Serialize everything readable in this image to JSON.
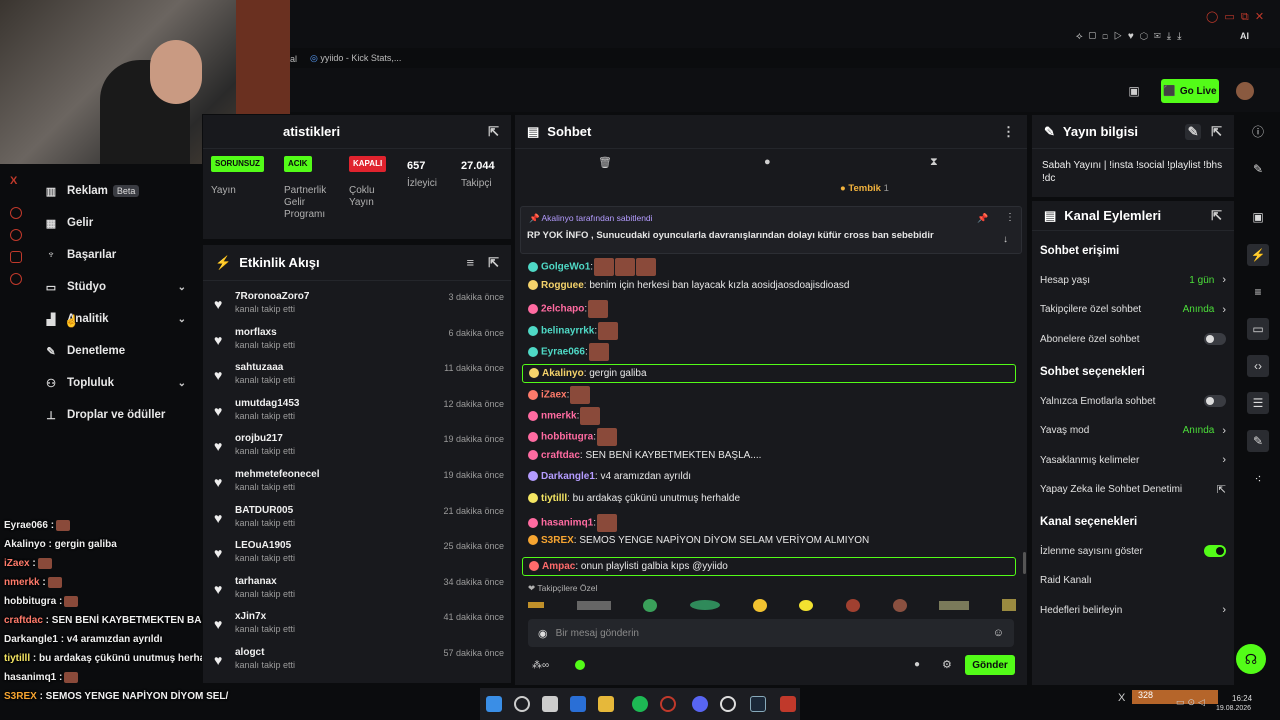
{
  "browser": {
    "tab_label_1": "ial",
    "tab_label_2": "yyiido - Kick Stats,..."
  },
  "top": {
    "go_live": "Go Live"
  },
  "left_menu": {
    "items": [
      {
        "label": "Reklam",
        "badge": "Beta",
        "icon": "megaphone-icon"
      },
      {
        "label": "Gelir",
        "icon": "revenue-icon"
      },
      {
        "label": "Başarılar",
        "icon": "trophy-icon"
      },
      {
        "label": "Stüdyo",
        "icon": "studio-icon",
        "chevron": true
      },
      {
        "label": "Analitik",
        "icon": "analytics-icon",
        "chevron": true
      },
      {
        "label": "Denetleme",
        "icon": "wrench-icon"
      },
      {
        "label": "Topluluk",
        "icon": "community-icon",
        "chevron": true
      },
      {
        "label": "Droplar ve ödüller",
        "icon": "drops-icon"
      }
    ]
  },
  "overlay_chat": [
    {
      "user": "Eyrae066",
      "text": " :",
      "color": "#f0f0f0"
    },
    {
      "user": "Akalinyo",
      "text": " : gergin galiba",
      "color": "#f0f0f0"
    },
    {
      "user": "iZaex",
      "text": " :",
      "color": "#ff7b6b"
    },
    {
      "user": "nmerkk",
      "text": " :",
      "color": "#ff7b6b"
    },
    {
      "user": "hobbitugra",
      "text": " :",
      "color": "#f0f0f0"
    },
    {
      "user": "craftdac",
      "text": " : SEN BENİ KAYBETMEKTEN BAŞLA...",
      "color": "#ff7b6b"
    },
    {
      "user": "Darkangle1",
      "text": " : v4 aramızdan ayrıldı",
      "color": "#f0f0f0"
    },
    {
      "user": "tiytilll",
      "text": " : bu ardakaş çükünü unutmuş herhalde",
      "color": "#f5e663"
    },
    {
      "user": "hasanimq1",
      "text": " :",
      "color": "#f0f0f0"
    },
    {
      "user": "S3REX",
      "text": " : SEMOS YENGE NAPİYON DİYOM SEL/",
      "color": "#f7a531"
    }
  ],
  "stats": {
    "title": "atistikleri",
    "cols": [
      {
        "pill": "SORUNSUZ",
        "pill_bg": "#53fc18",
        "pill_fg": "#0b0c0e",
        "label": "Yayın"
      },
      {
        "pill": "ACIK",
        "pill_bg": "#53fc18",
        "pill_fg": "#0b0c0e",
        "label": "Partnerlik Gelir Programı"
      },
      {
        "pill": "KAPALI",
        "pill_bg": "#e0232e",
        "pill_fg": "#ffffff",
        "label": "Çoklu Yayın"
      },
      {
        "value": "657",
        "label": "İzleyici"
      },
      {
        "value": "27.044",
        "label": "Takipçi"
      }
    ]
  },
  "activity": {
    "title": "Etkinlik Akışı",
    "rows": [
      {
        "name": "7RoronoaZoro7",
        "sub": "kanalı takip etti",
        "time": "3 dakika önce"
      },
      {
        "name": "morflaxs",
        "sub": "kanalı takip etti",
        "time": "6 dakika önce"
      },
      {
        "name": "sahtuzaaa",
        "sub": "kanalı takip etti",
        "time": "11 dakika önce"
      },
      {
        "name": "umutdag1453",
        "sub": "kanalı takip etti",
        "time": "12 dakika önce"
      },
      {
        "name": "orojbu217",
        "sub": "kanalı takip etti",
        "time": "19 dakika önce"
      },
      {
        "name": "mehmetefeonecel",
        "sub": "kanalı takip etti",
        "time": "19 dakika önce"
      },
      {
        "name": "BATDUR005",
        "sub": "kanalı takip etti",
        "time": "21 dakika önce"
      },
      {
        "name": "LEOuA1905",
        "sub": "kanalı takip etti",
        "time": "25 dakika önce"
      },
      {
        "name": "tarhanax",
        "sub": "kanalı takip etti",
        "time": "34 dakika önce"
      },
      {
        "name": "xJin7x",
        "sub": "kanalı takip etti",
        "time": "41 dakika önce"
      },
      {
        "name": "alogct",
        "sub": "kanalı takip etti",
        "time": "57 dakika önce"
      }
    ]
  },
  "chat": {
    "title": "Sohbet",
    "top_label": "Tembik",
    "top_count": "1",
    "pinned_by": "Akalinyo tarafından sabitlendi",
    "pinned_text": "RP YOK  İNFO , Sunucudaki oyuncularla davranışlarından dolayı küfür cross ban sebebidir",
    "messages": [
      {
        "user": "GolgeWo1",
        "text": ":",
        "color": "#4fd9c6",
        "emotes": 3
      },
      {
        "user": "Rogguee",
        "text": ": benim için herkesi ban layacak kızla aosidjaosdoajisdioasd",
        "color": "#f5d36b",
        "emotes": 0
      },
      {
        "user": "2elchapo",
        "text": ":",
        "color": "#ff6ba1",
        "emotes": 1
      },
      {
        "user": "belinayrrkk",
        "text": ":",
        "color": "#4fd9c6",
        "emotes": 1
      },
      {
        "user": "Eyrae066",
        "text": ":",
        "color": "#4fd9c6",
        "emotes": 1
      },
      {
        "user": "Akalinyo",
        "text": ": gergin galiba",
        "color": "#f5d36b",
        "emotes": 0
      },
      {
        "user": "iZaex",
        "text": ":",
        "color": "#ff7b6b",
        "emotes": 1
      },
      {
        "user": "nmerkk",
        "text": ":",
        "color": "#ff6ba1",
        "emotes": 1
      },
      {
        "user": "hobbitugra",
        "text": ":",
        "color": "#ff6ba1",
        "emotes": 1
      },
      {
        "user": "craftdac",
        "text": ": SEN BENİ KAYBETMEKTEN BAŞLA....",
        "color": "#ff6ba1",
        "emotes": 0
      },
      {
        "user": "Darkangle1",
        "text": ": v4 aramızdan ayrıldı",
        "color": "#b49cff",
        "emotes": 0
      },
      {
        "user": "tiytilll",
        "text": ": bu ardakaş çükünü unutmuş herhalde",
        "color": "#f5e663",
        "emotes": 0
      },
      {
        "user": "hasanimq1",
        "text": ":",
        "color": "#ff6ba1",
        "emotes": 1
      },
      {
        "user": "S3REX",
        "text": ": SEMOS YENGE NAPİYON DİYOM SELAM VERİYOM ALMIYON",
        "color": "#f7a531",
        "emotes": 0
      },
      {
        "user": "Ampac",
        "text": ": onun playlisti galbia kıps @yyiido",
        "color": "#ff6b6b",
        "emotes": 0
      }
    ],
    "followers_only": "Takipçilere Özel",
    "input_placeholder": "Bir mesaj gönderin",
    "send": "Gönder"
  },
  "stream_info": {
    "title": "Yayın bilgisi",
    "text": "Sabah Yayını | !insta !social !playlist !bhs !dc"
  },
  "channel_actions": {
    "title": "Kanal Eylemleri",
    "sections": [
      {
        "heading": "Sohbet erişimi",
        "rows": [
          {
            "label": "Hesap yaşı",
            "value": "1 gün",
            "type": "chevron"
          },
          {
            "label": "Takipçilere özel sohbet",
            "value": "Anında",
            "type": "chevron"
          },
          {
            "label": "Abonelere özel sohbet",
            "value": "",
            "type": "toggle-off"
          }
        ]
      },
      {
        "heading": "Sohbet seçenekleri",
        "rows": [
          {
            "label": "Yalnızca Emotlarla sohbet",
            "value": "",
            "type": "toggle-off"
          },
          {
            "label": "Yavaş mod",
            "value": "Anında",
            "type": "chevron"
          },
          {
            "label": "Yasaklanmış kelimeler",
            "value": "",
            "type": "chevron"
          },
          {
            "label": "Yapay Zeka ile Sohbet Denetimi",
            "value": "",
            "type": "external"
          }
        ]
      },
      {
        "heading": "Kanal seçenekleri",
        "rows": [
          {
            "label": "İzlenme sayısını göster",
            "value": "",
            "type": "toggle-on"
          },
          {
            "label": "Raid Kanalı",
            "value": "",
            "type": "none"
          },
          {
            "label": "Hedefleri belirleyin",
            "value": "",
            "type": "chevron"
          }
        ]
      }
    ]
  },
  "taskbar": {
    "counter": "328",
    "time": "16:24",
    "date": "19.08.2026"
  },
  "colors": {
    "accent": "#53fc18",
    "panel": "#18191d",
    "bg": "#0b0c0e"
  }
}
